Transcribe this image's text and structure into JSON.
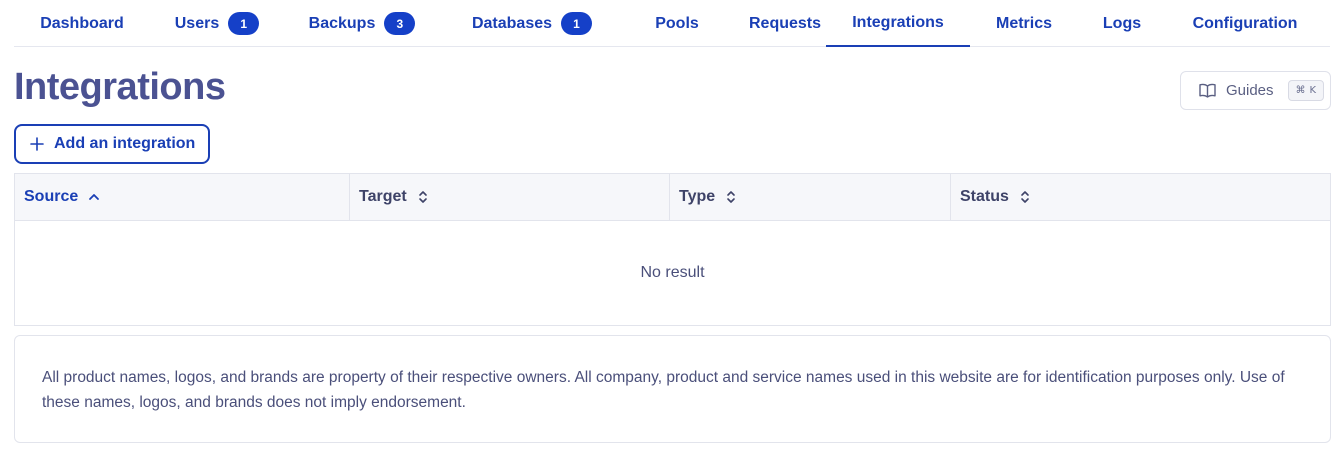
{
  "tabs": [
    {
      "label": "Dashboard",
      "badge": ""
    },
    {
      "label": "Users",
      "badge": "1"
    },
    {
      "label": "Backups",
      "badge": "3"
    },
    {
      "label": "Databases",
      "badge": "1"
    },
    {
      "label": "Pools",
      "badge": ""
    },
    {
      "label": "Requests",
      "badge": ""
    },
    {
      "label": "Integrations",
      "badge": "",
      "active": true
    },
    {
      "label": "Metrics",
      "badge": ""
    },
    {
      "label": "Logs",
      "badge": ""
    },
    {
      "label": "Configuration",
      "badge": ""
    }
  ],
  "header": {
    "title": "Integrations",
    "guides_label": "Guides",
    "guides_shortcut_symbol": "⌘",
    "guides_shortcut_key": "K"
  },
  "actions": {
    "add_integration_label": "Add an integration"
  },
  "table": {
    "columns": [
      {
        "label": "Source",
        "sort": "ascending"
      },
      {
        "label": "Target",
        "sort": "none"
      },
      {
        "label": "Type",
        "sort": "none"
      },
      {
        "label": "Status",
        "sort": "none"
      }
    ],
    "empty_text": "No result"
  },
  "footer": {
    "disclaimer": "All product names, logos, and brands are property of their respective owners. All company, product and service names used in this website are for identification purposes only. Use of these names, logos, and brands does not imply endorsement."
  },
  "colors": {
    "accent": "#1a3fb5",
    "badge": "#1540c8",
    "title": "#4b5292"
  },
  "icons": {
    "guides": "book-open-icon",
    "add": "plus-icon",
    "sort_ascending": "chevron-up-icon",
    "sort_none": "chevron-up-down-icon"
  }
}
